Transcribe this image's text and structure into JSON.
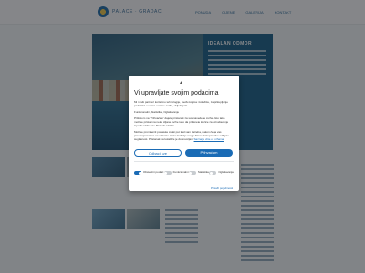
{
  "header": {
    "logo_text": "PALACE · GRADAC",
    "nav": [
      "Ponuda",
      "Cijene",
      "Galerija",
      "Kontakt"
    ]
  },
  "hero": {
    "panel_title": "IDEALAN ODMOR"
  },
  "consent": {
    "logo_text": "▲",
    "title": "Vi upravljate svojim podacima",
    "paragraphs": [
      "Mi i naši partneri koristimo tehnologije, među kojima i kolačiće, za prikupljanje podataka o vama u razne svrhe, uključujući:",
      "Funkcionalni, Statistike, Oglašavanje",
      "Pritiskom na 'Prihvaćam' dajete pristanak za sve navedene svrhe. Isto tako možete pristati na neke ciljane svrhe tako da pritisnete kućice za označavanje ispod i odaberete 'Potvrdi odabir'.",
      "Možete promijeniti postavke svaki put kad vam zatreba, nakon čega vas preusmjeravamo na stranicu. Neke funkcije mogu biti nedostupne ako odbijete suglasnost. Pristanak na kolačiće je dobrovoljan. "
    ],
    "more_link": "Saznajte više o svrhama",
    "reject_label": "Odbaci sve",
    "accept_label": "Prihvaćam",
    "toggles": [
      {
        "label": "Obavezni podaci",
        "on": true
      },
      {
        "label": "Funkcionalni",
        "on": false
      },
      {
        "label": "Statistike",
        "on": false
      },
      {
        "label": "Oglašavanje",
        "on": false
      }
    ],
    "details_label": "Prikaži pojedinosti"
  }
}
